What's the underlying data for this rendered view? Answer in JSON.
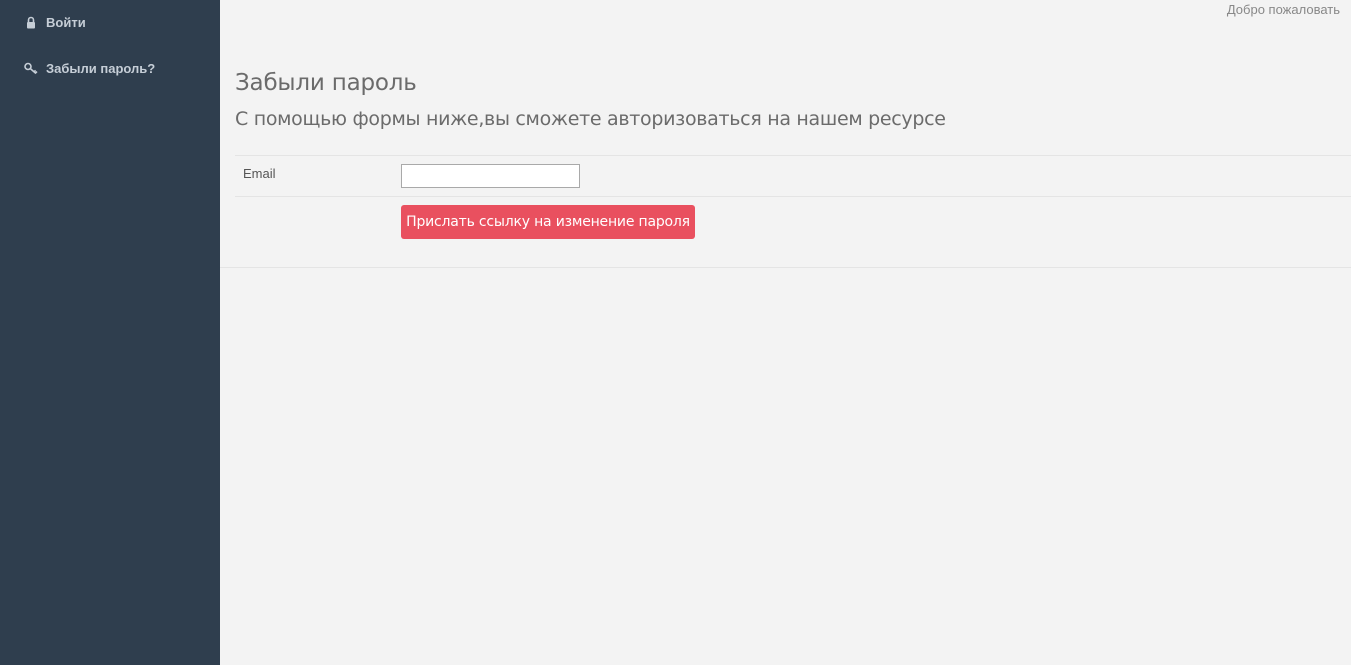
{
  "sidebar": {
    "items": [
      {
        "label": "Войти",
        "icon": "lock-icon"
      },
      {
        "label": "Забыли пароль?",
        "icon": "key-icon"
      }
    ]
  },
  "header": {
    "welcome": "Добро пожаловать"
  },
  "main": {
    "title": "Забыли пароль",
    "subtitle": "С помощью формы ниже,вы сможете авторизоваться на нашем ресурсе",
    "form": {
      "email_label": "Email",
      "email_value": "",
      "email_placeholder": "",
      "submit_label": "Прислать ссылку на изменение пароля"
    }
  },
  "colors": {
    "sidebar_bg": "#2f3e4e",
    "page_bg": "#f3f3f3",
    "accent": "#e9505f"
  }
}
